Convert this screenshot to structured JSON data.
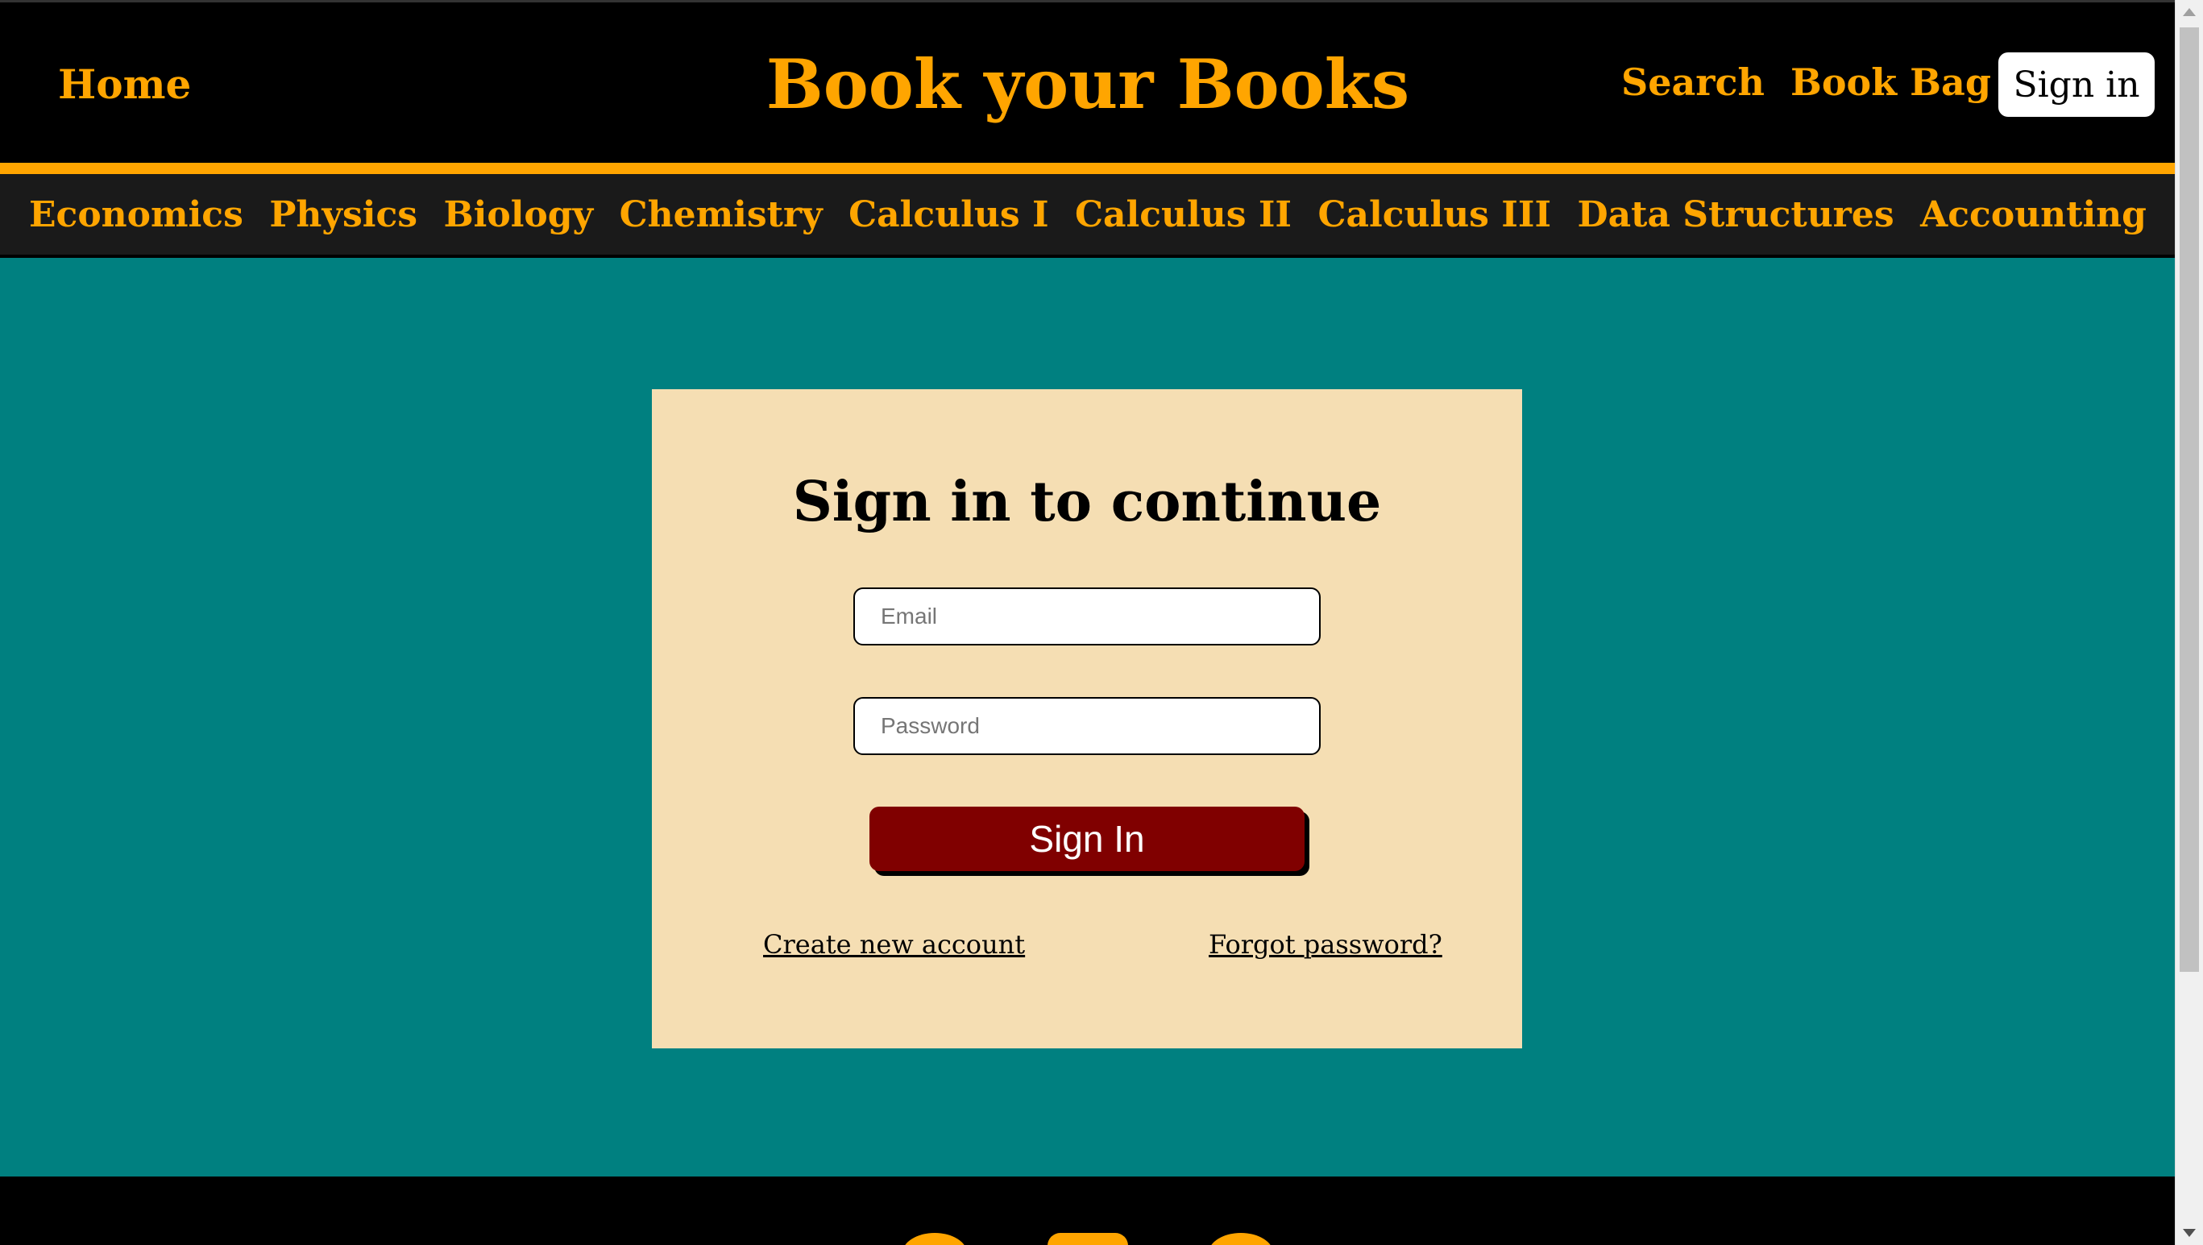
{
  "header": {
    "home": "Home",
    "brand": "Book your Books",
    "search": "Search",
    "book_bag": "Book Bag",
    "sign_in": "Sign in"
  },
  "subjects": [
    "Economics",
    "Physics",
    "Biology",
    "Chemistry",
    "Calculus I",
    "Calculus II",
    "Calculus III",
    "Data Structures",
    "Accounting"
  ],
  "login": {
    "title": "Sign in to continue",
    "email_placeholder": "Email",
    "password_placeholder": "Password",
    "submit": "Sign In",
    "create_account": "Create new account",
    "forgot_password": "Forgot password?"
  },
  "footer": {
    "social_icons": [
      "social-icon-1",
      "social-icon-2",
      "social-icon-3"
    ]
  },
  "colors": {
    "page_bg": "#008080",
    "accent": "#ffa500",
    "card_bg": "#f5deb3",
    "button": "#800000",
    "header_bg": "#000000",
    "nav_bg": "#1a1a1a"
  }
}
